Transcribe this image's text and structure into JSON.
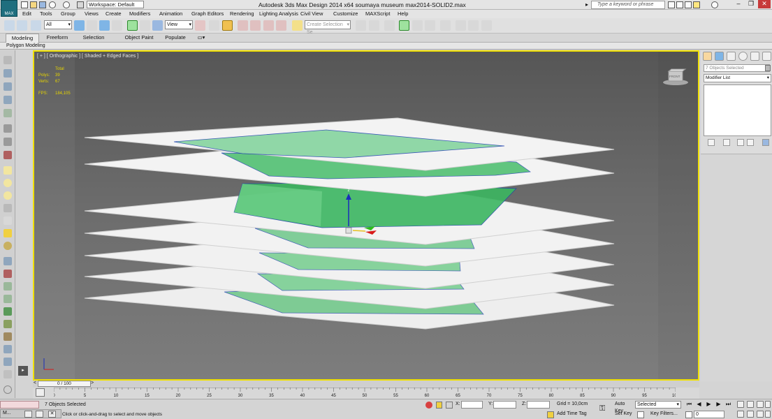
{
  "window": {
    "title": "Autodesk 3ds Max Design 2014 x64      soumaya museum max2014-SOLID2.max",
    "workspace": "Workspace: Default",
    "help_search_placeholder": "Type a keyword or phrase",
    "app_logo": "MAX"
  },
  "menu": [
    "Edit",
    "Tools",
    "Group",
    "Views",
    "Create",
    "Modifiers",
    "Animation",
    "Graph Editors",
    "Rendering",
    "Lighting Analysis",
    "Civil View",
    "Customize",
    "MAXScript",
    "Help"
  ],
  "toolbar": {
    "selection_filter": "All",
    "reference_coord": "View",
    "named_selection_placeholder": "Create Selection Se"
  },
  "ribbon": {
    "tabs": [
      "Modeling",
      "Freeform",
      "Selection",
      "Object Paint",
      "Populate"
    ],
    "active_tab": "Modeling",
    "panel_label": "Polygon Modeling"
  },
  "viewport": {
    "label": "[ + ] [ Orthographic ] [ Shaded + Edged Faces ]",
    "stats": {
      "header": "Total",
      "polys_label": "Polys:",
      "polys_value": "39",
      "verts_label": "Verts:",
      "verts_value": "67",
      "fps_label": "FPS:",
      "fps_value": "184,105"
    },
    "viewcube_label": "FRONT"
  },
  "command_panel": {
    "object_field": "7 Objects Selected",
    "modifier_list": "Modifier List"
  },
  "time_slider": {
    "current": "0 / 100"
  },
  "track_ticks": [
    "0",
    "5",
    "10",
    "15",
    "20",
    "25",
    "30",
    "35",
    "40",
    "45",
    "50",
    "55",
    "60",
    "65",
    "70",
    "75",
    "80",
    "85",
    "90",
    "95",
    "100"
  ],
  "status": {
    "objects_selected": "7 Objects Selected",
    "prompt": "Click or click-and-drag to select and move objects",
    "x_label": "X:",
    "y_label": "Y:",
    "z_label": "Z:",
    "grid": "Grid = 10,0cm",
    "add_time_tag": "Add Time Tag",
    "auto_key": "Auto Key",
    "set_key": "Set Key",
    "key_mode": "Selected",
    "key_filters": "Key Filters...",
    "frame": "0",
    "maxscript_prefix": "M..."
  },
  "colors": {
    "viewport_border": "#f0e000",
    "slab_fill": "#f2f2f2",
    "glass_green": "#3fbf6a",
    "gizmo_y": "#2dbb1a",
    "gizmo_x": "#d81a1a",
    "gizmo_z": "#1a2dbb"
  }
}
